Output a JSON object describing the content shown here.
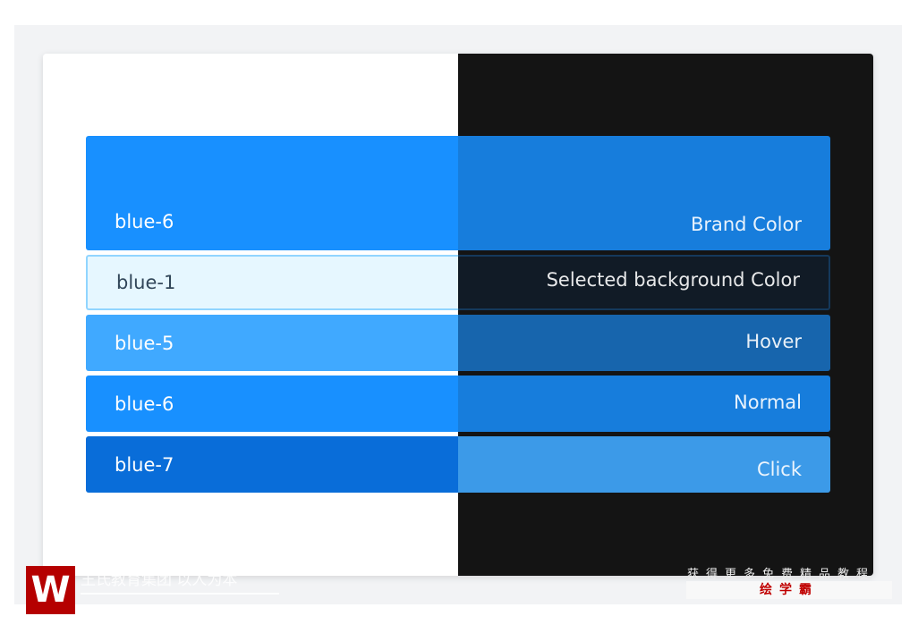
{
  "rows": [
    {
      "label": "blue-6",
      "light": "#1890ff",
      "dark": "#177ddc",
      "desc": "Brand Color"
    },
    {
      "label": "blue-1",
      "light": "#e6f7ff",
      "dark": "#111b26",
      "desc": "Selected background Color"
    },
    {
      "label": "blue-5",
      "light": "#40a9ff",
      "dark": "#1765ad",
      "desc": "Hover"
    },
    {
      "label": "blue-6",
      "light": "#1890ff",
      "dark": "#177ddc",
      "desc": "Normal"
    },
    {
      "label": "blue-7",
      "light": "#096dd9",
      "dark": "#3c9ae8",
      "desc": "Click"
    }
  ],
  "watermark": {
    "left_text": "王氏教育集团 以人为本",
    "right_text": "获得更多免费精品教程",
    "right_brand": "绘学霸",
    "logo_letter": "W"
  }
}
